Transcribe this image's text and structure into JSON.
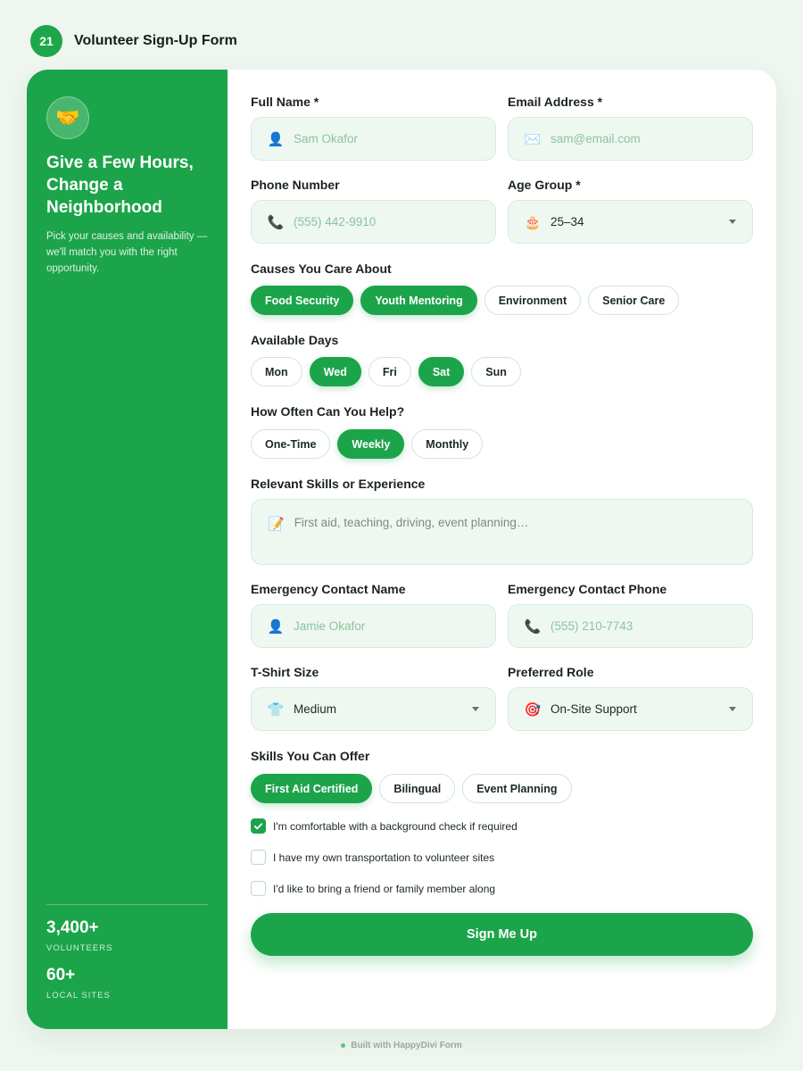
{
  "header": {
    "step": "21",
    "title": "Volunteer Sign-Up Form"
  },
  "sidebar": {
    "icon": "handshake-icon",
    "icon_glyph": "🤝",
    "title": "Give a Few Hours, Change a Neighborhood",
    "description": "Pick your causes and availability — we'll match you with the right opportunity.",
    "stats": [
      {
        "value": "3,400+",
        "label": "VOLUNTEERS"
      },
      {
        "value": "60+",
        "label": "LOCAL SITES"
      }
    ]
  },
  "form": {
    "full_name": {
      "label": "Full Name *",
      "placeholder": "Sam Okafor",
      "icon": "user-icon",
      "icon_glyph": "👤"
    },
    "email": {
      "label": "Email Address *",
      "placeholder": "sam@email.com",
      "icon": "envelope-icon",
      "icon_glyph": "✉️"
    },
    "phone": {
      "label": "Phone Number",
      "placeholder": "(555) 442-9910",
      "icon": "phone-icon",
      "icon_glyph": "📞"
    },
    "age_group": {
      "label": "Age Group *",
      "value": "25–34",
      "icon": "cake-icon",
      "icon_glyph": "🎂"
    },
    "causes": {
      "label": "Causes You Care About",
      "options": [
        {
          "label": "Food Security",
          "selected": true
        },
        {
          "label": "Youth Mentoring",
          "selected": true
        },
        {
          "label": "Environment",
          "selected": false
        },
        {
          "label": "Senior Care",
          "selected": false
        }
      ]
    },
    "days": {
      "label": "Available Days",
      "options": [
        {
          "label": "Mon",
          "selected": false
        },
        {
          "label": "Wed",
          "selected": true
        },
        {
          "label": "Fri",
          "selected": false
        },
        {
          "label": "Sat",
          "selected": true
        },
        {
          "label": "Sun",
          "selected": false
        }
      ]
    },
    "frequency": {
      "label": "How Often Can You Help?",
      "options": [
        {
          "label": "One-Time",
          "selected": false
        },
        {
          "label": "Weekly",
          "selected": true
        },
        {
          "label": "Monthly",
          "selected": false
        }
      ]
    },
    "skills_text": {
      "label": "Relevant Skills or Experience",
      "placeholder": "First aid, teaching, driving, event planning…",
      "icon": "memo-icon",
      "icon_glyph": "📝"
    },
    "emergency_name": {
      "label": "Emergency Contact Name",
      "placeholder": "Jamie Okafor",
      "icon": "user-icon",
      "icon_glyph": "👤"
    },
    "emergency_phone": {
      "label": "Emergency Contact Phone",
      "placeholder": "(555) 210-7743",
      "icon": "phone-icon",
      "icon_glyph": "📞"
    },
    "tshirt": {
      "label": "T-Shirt Size",
      "value": "Medium",
      "icon": "tshirt-icon",
      "icon_glyph": "👕"
    },
    "role": {
      "label": "Preferred Role",
      "value": "On-Site Support",
      "icon": "target-icon",
      "icon_glyph": "🎯"
    },
    "skills_offer": {
      "label": "Skills You Can Offer",
      "options": [
        {
          "label": "First Aid Certified",
          "selected": true
        },
        {
          "label": "Bilingual",
          "selected": false
        },
        {
          "label": "Event Planning",
          "selected": false
        }
      ]
    },
    "checkboxes": [
      {
        "label": "I'm comfortable with a background check if required",
        "checked": true
      },
      {
        "label": "I have my own transportation to volunteer sites",
        "checked": false
      },
      {
        "label": "I'd like to bring a friend or family member along",
        "checked": false
      }
    ],
    "submit_label": "Sign Me Up"
  },
  "footer": {
    "text": "Built with HappyDivi Form"
  },
  "colors": {
    "accent": "#1ca44a",
    "field_bg": "#eef8f1",
    "page_bg": "#eef6ef"
  }
}
